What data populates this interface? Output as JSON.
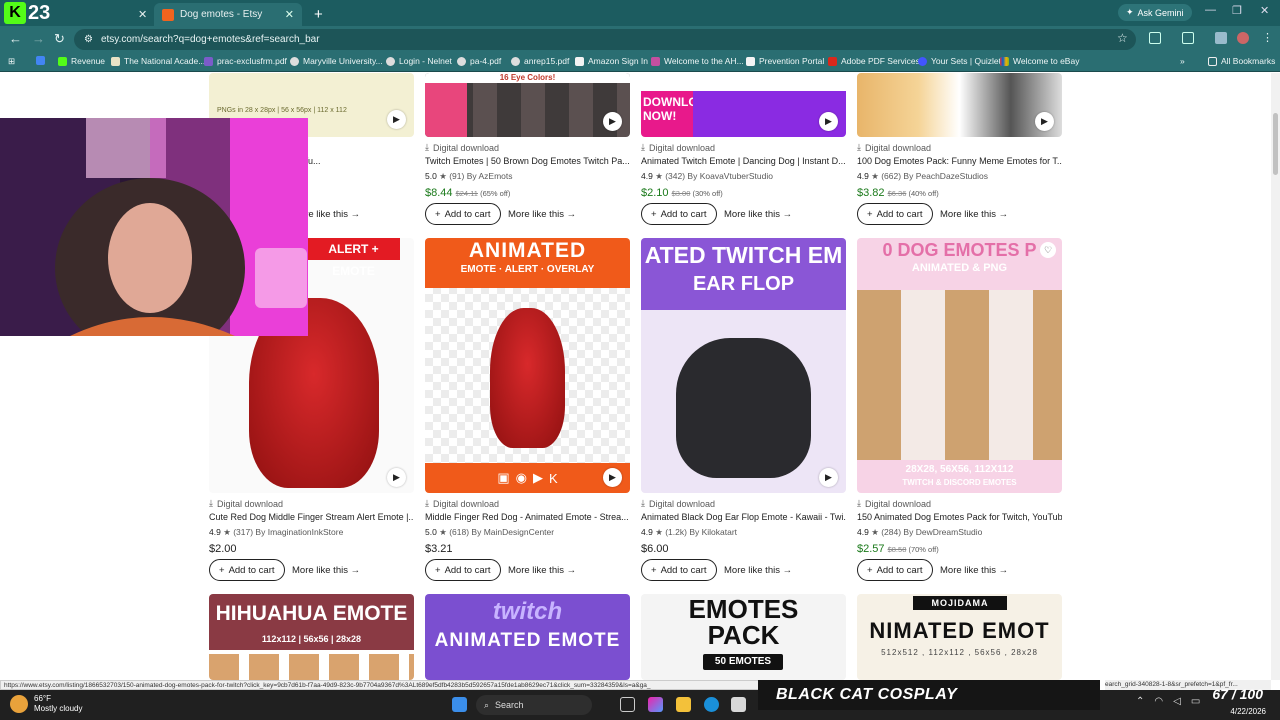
{
  "tabs": [
    {
      "label": "Dog emotes - Etsy",
      "active": true
    }
  ],
  "stream_counter": "23",
  "gemini_label": "Ask Gemini",
  "url": "etsy.com/search?q=dog+emotes&ref=search_bar",
  "bookmarks": [
    "Revenue",
    "The National Acade...",
    "prac-exclusfrm.pdf",
    "Maryville University...",
    "Login - Nelnet",
    "pa-4.pdf",
    "anrep15.pdf",
    "Amazon Sign In",
    "Welcome to the AH...",
    "Prevention Portal",
    "Adobe PDF Services",
    "Your Sets | Quizlet",
    "Welcome to eBay"
  ],
  "all_bookmarks": "All Bookmarks",
  "rows": [
    [
      {
        "img_caption": "PNGs in 28 x 28px | 56 x 56px | 112 x 112",
        "dl": "Digital download",
        "title": "...r Twitch, Discord, YouTu...",
        "rating": "",
        "reviews": "",
        "shop": "",
        "price": "",
        "orig": "",
        "off": "",
        "atc": "Add to cart",
        "more": "More like this"
      },
      {
        "img_caption": "16 Eye Colors!",
        "dl": "Digital download",
        "title": "Twitch Emotes | 50 Brown Dog Emotes Twitch Pa...",
        "rating": "5.0",
        "reviews": "(91)",
        "shop": "By AzEmots",
        "price": "$8.44",
        "orig": "$24.11",
        "off": "(65% off)",
        "atc": "Add to cart",
        "more": "More like this"
      },
      {
        "img_caption": "DOWNLOAD NOW!",
        "dl": "Digital download",
        "title": "Animated Twitch Emote | Dancing Dog | Instant D...",
        "rating": "4.9",
        "reviews": "(342)",
        "shop": "By KoavaVtuberStudio",
        "price": "$2.10",
        "orig": "$3.00",
        "off": "(30% off)",
        "atc": "Add to cart",
        "more": "More like this"
      },
      {
        "img_caption": "",
        "dl": "Digital download",
        "title": "100 Dog Emotes Pack: Funny Meme Emotes for T...",
        "rating": "4.9",
        "reviews": "(662)",
        "shop": "By PeachDazeStudios",
        "price": "$3.82",
        "orig": "$6.36",
        "off": "(40% off)",
        "atc": "Add to cart",
        "more": "More like this"
      }
    ],
    [
      {
        "img_caption": "ALERT + EMOTE",
        "dl": "Digital download",
        "title": "Cute Red Dog Middle Finger Stream Alert Emote |...",
        "rating": "4.9",
        "reviews": "(317)",
        "shop": "By ImaginationInkStore",
        "price": "$2.00",
        "orig": "",
        "off": "",
        "atc": "Add to cart",
        "more": "More like this"
      },
      {
        "img_caption": "ANIMATED",
        "img_sub": "EMOTE · ALERT · OVERLAY",
        "dl": "Digital download",
        "title": "Middle Finger Red Dog - Animated Emote - Strea...",
        "rating": "5.0",
        "reviews": "(618)",
        "shop": "By MainDesignCenter",
        "price": "$3.21",
        "orig": "",
        "off": "",
        "atc": "Add to cart",
        "more": "More like this"
      },
      {
        "img_caption": "ATED TWITCH EM",
        "img_sub": "EAR FLOP",
        "dl": "Digital download",
        "title": "Animated Black Dog Ear Flop Emote - Kawaii - Twi...",
        "rating": "4.9",
        "reviews": "(1.2k)",
        "shop": "By Kilokatart",
        "price": "$6.00",
        "orig": "",
        "off": "",
        "atc": "Add to cart",
        "more": "More like this"
      },
      {
        "img_caption": "0 DOG EMOTES P",
        "img_sub": "ANIMATED & PNG",
        "img_foot": "28X28, 56X56, 112X112",
        "img_foot2": "TWITCH & DISCORD EMOTES",
        "dl": "Digital download",
        "title": "150 Animated Dog Emotes Pack for Twitch, YouTub...",
        "rating": "4.9",
        "reviews": "(284)",
        "shop": "By DewDreamStudio",
        "price": "$2.57",
        "orig": "$8.58",
        "off": "(70% off)",
        "atc": "Add to cart",
        "more": "More like this"
      }
    ],
    [
      {
        "img_caption": "HIHUAHUA EMOTE",
        "img_sub": "112x112 | 56x56 | 28x28"
      },
      {
        "img_caption": "twitch",
        "img_sub": "ANIMATED EMOTE"
      },
      {
        "img_caption": "EMOTES",
        "img_sub": "PACK",
        "img_foot": "50 EMOTES"
      },
      {
        "img_caption": "MOJIDAMA",
        "img_sub": "NIMATED EMOT",
        "img_foot": "512x512 , 112x112 , 56x56 , 28x28"
      }
    ]
  ],
  "status_url": "https://www.etsy.com/listing/1866532703/150-animated-dog-emotes-pack-for-twitch?click_key=9cb7d61b-f7aa-49d9-823c-9b7704a9367d%3ALt689ef5dfb4283b5d592657a15fde1ab8629ec71&click_sum=33284359&ls=a&ga_",
  "status_url_tail": "earch_grid-340828-1-8&sr_prefetch=1&pf_fr...",
  "weather_temp": "66°F",
  "weather_desc": "Mostly cloudy",
  "search_label": "Search",
  "banner_text": "BLACK CAT COSPLAY",
  "counter": "67 / 100",
  "clock_date": "4/22/2026",
  "colors": {
    "etsy_orange": "#f1641e",
    "chrome_teal": "#2a6e72",
    "sale_green": "#1b7a1b"
  }
}
